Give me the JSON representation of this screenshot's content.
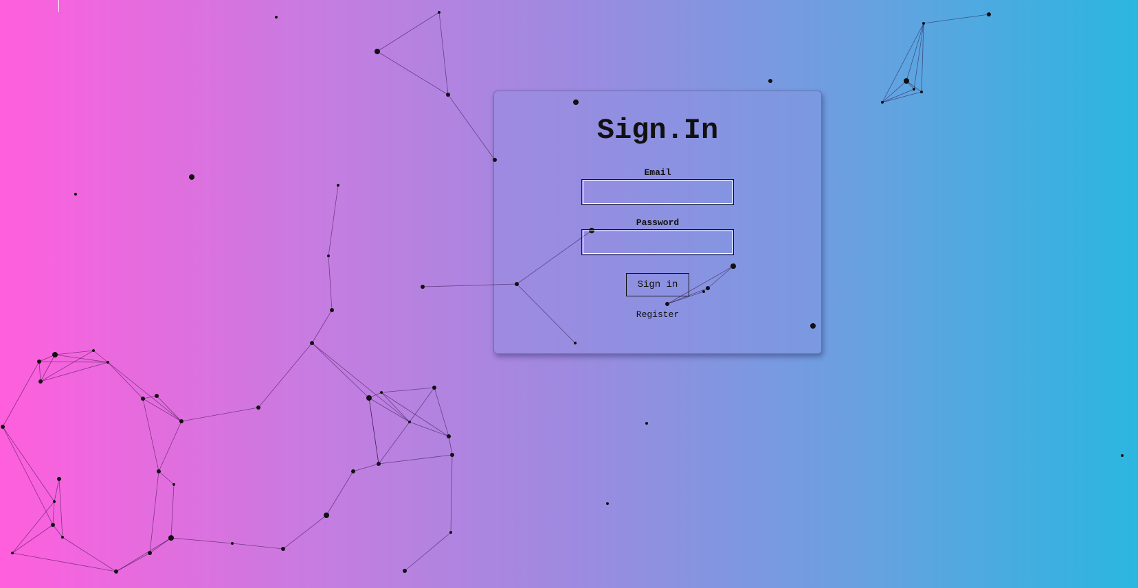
{
  "signin": {
    "title": "Sign.In",
    "email_label": "Email",
    "email_value": "",
    "password_label": "Password",
    "password_value": "",
    "submit_label": "Sign in",
    "register_label": "Register"
  },
  "background": {
    "gradient_start": "#ff5fdd",
    "gradient_end": "#2bb6e0",
    "decoration": "particle-network"
  }
}
